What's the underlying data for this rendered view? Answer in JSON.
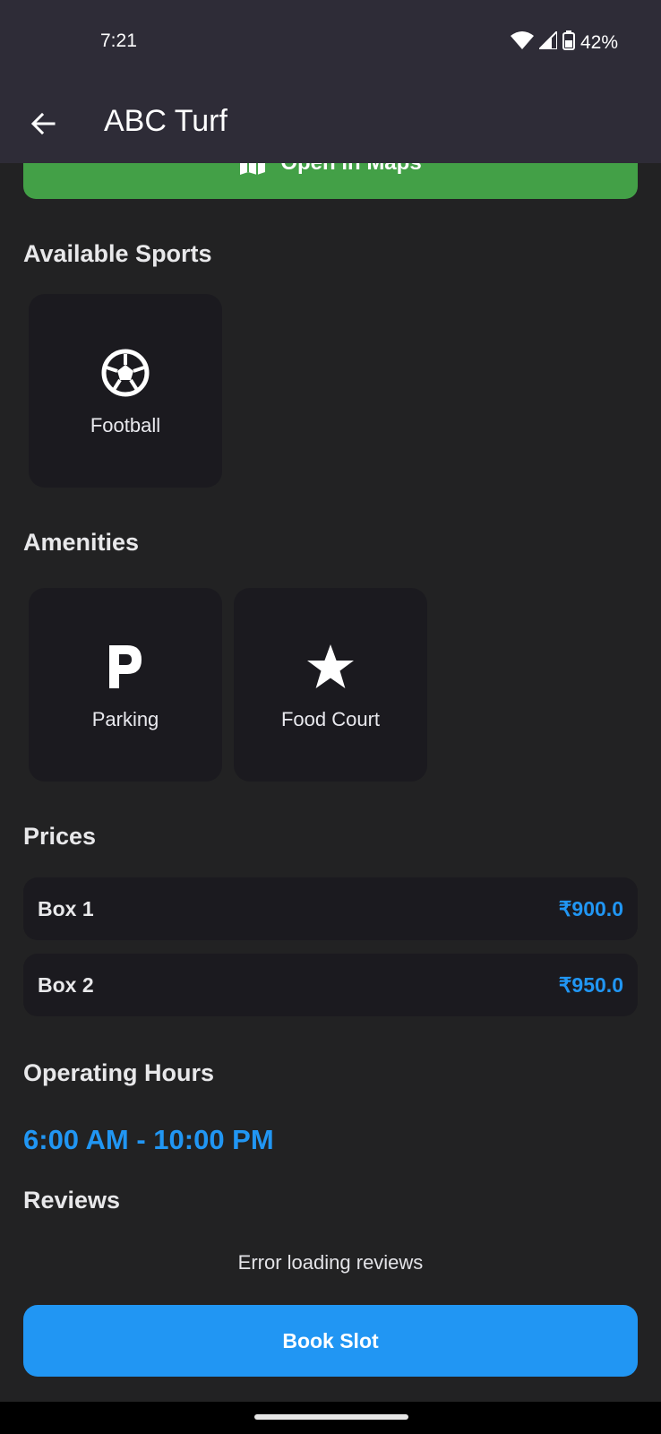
{
  "status_bar": {
    "time": "7:21",
    "battery": "42%"
  },
  "app_bar": {
    "title": "ABC Turf"
  },
  "maps_button": {
    "label": "Open in Maps"
  },
  "sports": {
    "heading": "Available Sports",
    "items": [
      {
        "label": "Football",
        "icon": "soccer-ball-icon"
      }
    ]
  },
  "amenities": {
    "heading": "Amenities",
    "items": [
      {
        "label": "Parking",
        "icon": "parking-icon"
      },
      {
        "label": "Food Court",
        "icon": "star-icon"
      }
    ]
  },
  "prices": {
    "heading": "Prices",
    "rows": [
      {
        "name": "Box 1",
        "price": "₹900.0"
      },
      {
        "name": "Box 2",
        "price": "₹950.0"
      }
    ]
  },
  "operating_hours": {
    "heading": "Operating Hours",
    "value": "6:00 AM - 10:00 PM"
  },
  "reviews": {
    "heading": "Reviews",
    "message": "Error loading reviews"
  },
  "book_button": {
    "label": "Book Slot"
  },
  "colors": {
    "background": "#222223",
    "bar": "#2e2c37",
    "card": "#1b1a1f",
    "maps_green": "#43a047",
    "accent_blue": "#2196f3"
  }
}
